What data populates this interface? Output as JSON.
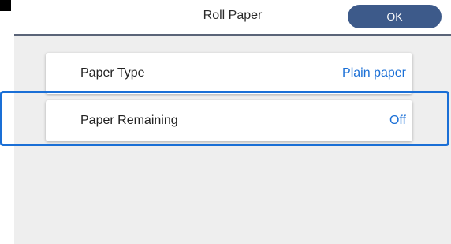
{
  "header": {
    "title": "Roll Paper",
    "ok_label": "OK"
  },
  "settings": [
    {
      "label": "Paper Type",
      "value": "Plain paper"
    },
    {
      "label": "Paper Remaining",
      "value": "Off"
    }
  ],
  "colors": {
    "accent": "#1a6fd6",
    "ok_button": "#3d5a8a",
    "panel_background": "#eeeeee"
  }
}
